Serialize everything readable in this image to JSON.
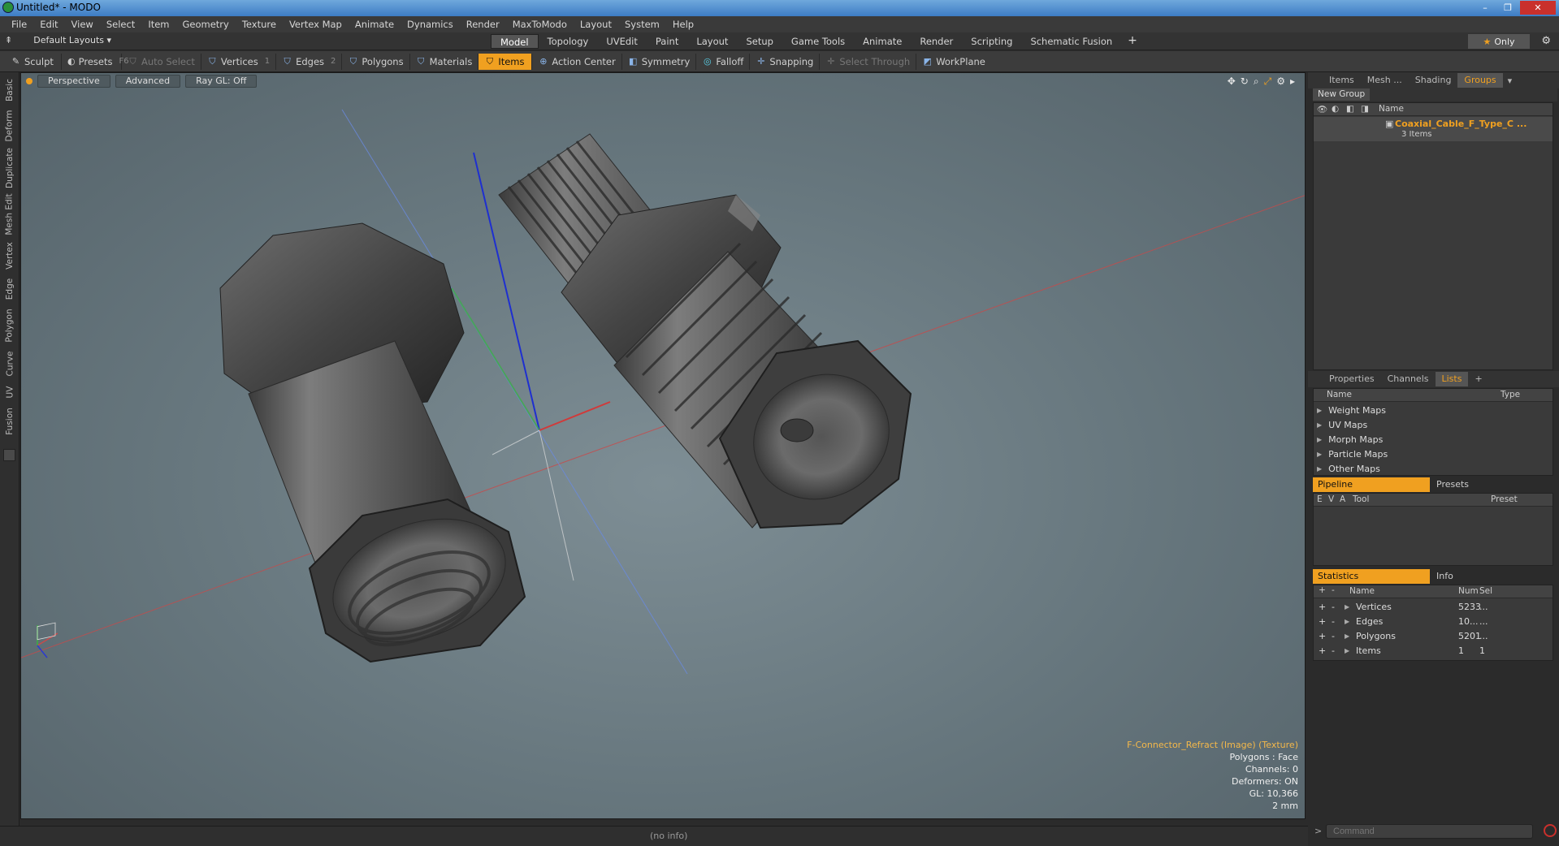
{
  "window": {
    "title": "Untitled* - MODO",
    "controls": [
      "–",
      "❐",
      "✕"
    ]
  },
  "menu": [
    "File",
    "Edit",
    "View",
    "Select",
    "Item",
    "Geometry",
    "Texture",
    "Vertex Map",
    "Animate",
    "Dynamics",
    "Render",
    "MaxToModo",
    "Layout",
    "System",
    "Help"
  ],
  "layouts": {
    "label": "Default Layouts",
    "arrow": "▾"
  },
  "tabs": [
    "Model",
    "Topology",
    "UVEdit",
    "Paint",
    "Layout",
    "Setup",
    "Game Tools",
    "Animate",
    "Render",
    "Scripting",
    "Schematic Fusion"
  ],
  "tabs_active": "Model",
  "tabs_plus": "+",
  "only_label": "Only",
  "toolbar": {
    "sculpt": "Sculpt",
    "presets": "Presets",
    "presets_key": "F6",
    "auto_select": "Auto Select",
    "vertices": "Vertices",
    "vertices_count": "1",
    "edges": "Edges",
    "edges_count": "2",
    "polygons": "Polygons",
    "materials": "Materials",
    "items": "Items",
    "action_center": "Action Center",
    "symmetry": "Symmetry",
    "falloff": "Falloff",
    "snapping": "Snapping",
    "select_through": "Select Through",
    "workplane": "WorkPlane"
  },
  "left_tabs": [
    "Basic",
    "Deform",
    "Duplicate",
    "Mesh Edit",
    "Vertex",
    "Edge",
    "Polygon",
    "Curve",
    "UV",
    "Fusion"
  ],
  "viewport": {
    "view": "Perspective",
    "advanced": "Advanced",
    "raygl": "Ray GL: Off",
    "info": {
      "texture": "F-Connector_Refract (Image) (Texture)",
      "polygons": "Polygons : Face",
      "channels": "Channels: 0",
      "deformers": "Deformers: ON",
      "gl": "GL: 10,366",
      "scale": "2 mm"
    }
  },
  "status": "(no info)",
  "groups_panel": {
    "tabs": [
      "Items",
      "Mesh ...",
      "Shading",
      "Groups"
    ],
    "active": "Groups",
    "new_group": "New Group",
    "col_name": "Name",
    "item_name": "Coaxial_Cable_F_Type_C ...",
    "item_sub": "3 Items"
  },
  "lists_panel": {
    "tabs": [
      "Properties",
      "Channels",
      "Lists"
    ],
    "active": "Lists",
    "plus": "+",
    "col_name": "Name",
    "col_type": "Type",
    "rows": [
      "Weight Maps",
      "UV Maps",
      "Morph Maps",
      "Particle Maps",
      "Other Maps"
    ]
  },
  "pipeline_panel": {
    "tabs": [
      "Pipeline",
      "Presets"
    ],
    "cols": [
      "E",
      "V",
      "A",
      "Tool",
      "Preset"
    ]
  },
  "stats_panel": {
    "tabs": [
      "Statistics",
      "Info"
    ],
    "col_name": "Name",
    "col_num": "Num",
    "col_sel": "Sel",
    "rows": [
      {
        "name": "Vertices",
        "num": "5233",
        "sel": "..."
      },
      {
        "name": "Edges",
        "num": "10...",
        "sel": "..."
      },
      {
        "name": "Polygons",
        "num": "5201",
        "sel": "..."
      },
      {
        "name": "Items",
        "num": "1",
        "sel": "1"
      }
    ]
  },
  "command": {
    "placeholder": "Command"
  },
  "colors": {
    "accent": "#f0a020",
    "viewport_bg": "#6b7a81",
    "axis_x": "#d03a3a",
    "axis_y": "#3aa03a",
    "axis_z": "#2a3ad0"
  }
}
